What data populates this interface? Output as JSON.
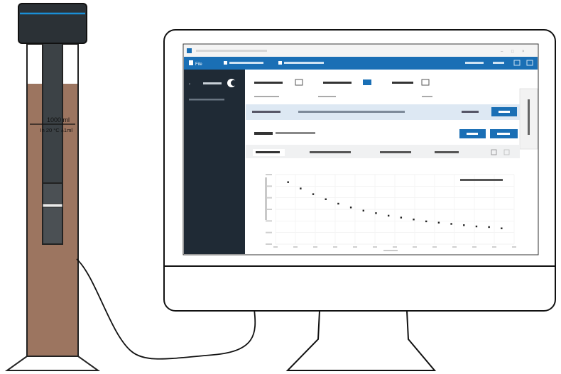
{
  "cylinder": {
    "volume_label": "1000 ml",
    "calibration_label": "In 20 °C ±1ml",
    "liquid_color": "#9c7560",
    "cap_color": "#2b3136",
    "accent_color": "#1a8fd6"
  },
  "software": {
    "window_title": "",
    "toolbar": {
      "files_label": "File",
      "left_menu": "",
      "center_menu": "",
      "right_items": [
        "",
        ""
      ]
    },
    "sidebar": {
      "title": "",
      "subtitle": ""
    },
    "header_fields": [
      {
        "label": "",
        "value": ""
      },
      {
        "label": "",
        "value": ""
      },
      {
        "label": "",
        "value": ""
      }
    ],
    "right_tab_label": "",
    "message_row": {
      "label": "",
      "text": "",
      "date": "",
      "button": ""
    },
    "section_title": "",
    "action_buttons": [
      "",
      ""
    ],
    "tabs": [
      "",
      "",
      "",
      ""
    ],
    "legend": "",
    "colors": {
      "topbar": "#1a6fb5",
      "sidebar": "#1f2a35",
      "accent": "#1a8fd6"
    }
  },
  "chart_data": {
    "type": "scatter",
    "title": "",
    "xlabel": "",
    "ylabel": "",
    "series": [
      {
        "name": "",
        "points": [
          [
            1,
            0.98
          ],
          [
            2,
            0.88
          ],
          [
            3,
            0.79
          ],
          [
            4,
            0.71
          ],
          [
            5,
            0.64
          ],
          [
            6,
            0.58
          ],
          [
            7,
            0.53
          ],
          [
            8,
            0.49
          ],
          [
            9,
            0.45
          ],
          [
            10,
            0.42
          ],
          [
            11,
            0.39
          ],
          [
            12,
            0.36
          ],
          [
            13,
            0.34
          ],
          [
            14,
            0.32
          ],
          [
            15,
            0.3
          ],
          [
            16,
            0.28
          ],
          [
            17,
            0.27
          ],
          [
            18,
            0.25
          ]
        ]
      }
    ],
    "xlim": [
      0,
      19
    ],
    "ylim": [
      0,
      1.1
    ],
    "grid": true,
    "legend_position": "top-right"
  }
}
